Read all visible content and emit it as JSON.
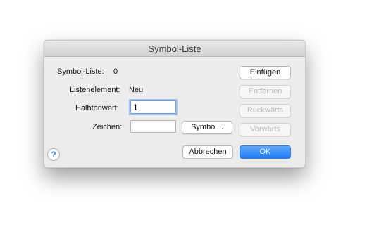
{
  "dialog": {
    "title": "Symbol-Liste",
    "labels": {
      "symbol_liste": "Symbol-Liste:",
      "symbol_liste_value": "0",
      "listenelement": "Listenelement:",
      "listenelement_value": "Neu",
      "halbtonwert": "Halbtonwert:",
      "zeichen": "Zeichen:"
    },
    "fields": {
      "halbtonwert_value": "1",
      "zeichen_value": ""
    },
    "buttons": {
      "einfuegen": "Einfügen",
      "entfernen": "Entfernen",
      "rueckwaerts": "Rückwärts",
      "vorwaerts": "Vorwärts",
      "symbol": "Symbol...",
      "abbrechen": "Abbrechen",
      "ok": "OK"
    },
    "help_icon": "?"
  }
}
